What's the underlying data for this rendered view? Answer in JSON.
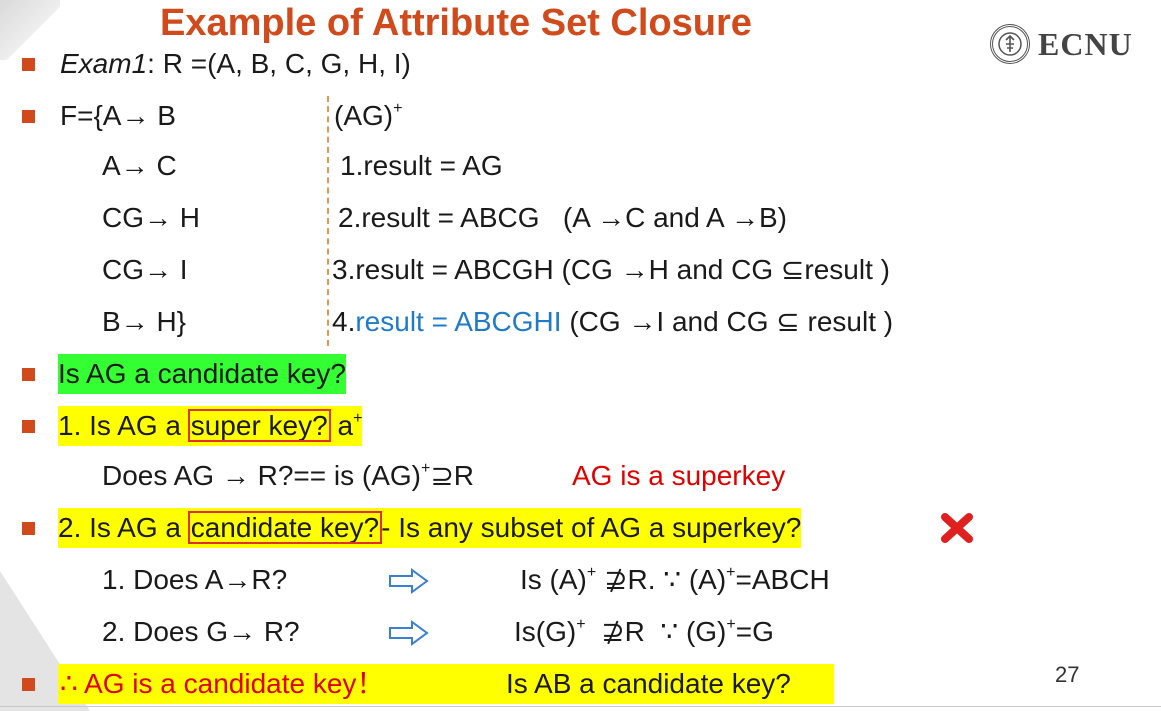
{
  "slide": {
    "title": "Example of Attribute Set Closure",
    "logo_text": "ECNU",
    "page_number": "27"
  },
  "exam": {
    "label": "Exam1",
    "relation": ": R =(A, B, C, G, H, I)"
  },
  "fds": {
    "line1": "F={A→ B",
    "line2": "A→ C",
    "line3": "CG→ H",
    "line4": "CG→ I",
    "line5": "B→ H}"
  },
  "closure": {
    "header_base": "(AG)",
    "header_sup": "+",
    "step1": "1.result = AG",
    "step2": "2.result = ABCG   (A →C and A →B)",
    "step3": "3.result = ABCGH (CG →H and CG ⊆result )",
    "step4_prefix": "4.",
    "step4_blue": "result = ABCGHI",
    "step4_rest": " (CG →I and CG ⊆ result )"
  },
  "questions": {
    "q_candidate": "Is AG a candidate key?",
    "q1_pre": "1. Is AG a ",
    "q1_box": "super key?",
    "q1_post_base": " a",
    "q1_post_sup": "+",
    "q1_detail_a": "Does AG → R?== is (AG)",
    "q1_detail_sup": "+",
    "q1_detail_b": "⊇R",
    "q1_answer": "AG is a superkey",
    "q2_pre": "2. Is AG a ",
    "q2_box": "candidate key?",
    "q2_post": "- Is any subset of AG a superkey?",
    "sub1_q": "1. Does A→R?",
    "sub1_a_pre": "Is (A)",
    "sub1_a_sup": "+",
    "sub1_a_mid": " ⊉R. ∵ (A)",
    "sub1_a_sup2": "+",
    "sub1_a_end": "=ABCH",
    "sub2_q": "2. Does G→ R?",
    "sub2_a_pre": "Is(G)",
    "sub2_a_sup": "+",
    "sub2_a_mid": "  ⊉R  ∵ (G)",
    "sub2_a_sup2": "+",
    "sub2_a_end": "=G",
    "conclusion": "∴ AG is a candidate key！",
    "followup": "Is AB a candidate key?"
  },
  "icons": {
    "bullet": "square-bullet-icon",
    "arrow": "hollow-right-arrow-icon",
    "cross": "red-cross-icon"
  },
  "colors": {
    "title": "#d04a1b",
    "bullet": "#d04a1b",
    "highlight_green": "#33ff33",
    "highlight_yellow": "#ffff00",
    "red_text": "#e00000",
    "blue_text": "#1f7bc9",
    "box_outline": "#e03030"
  }
}
